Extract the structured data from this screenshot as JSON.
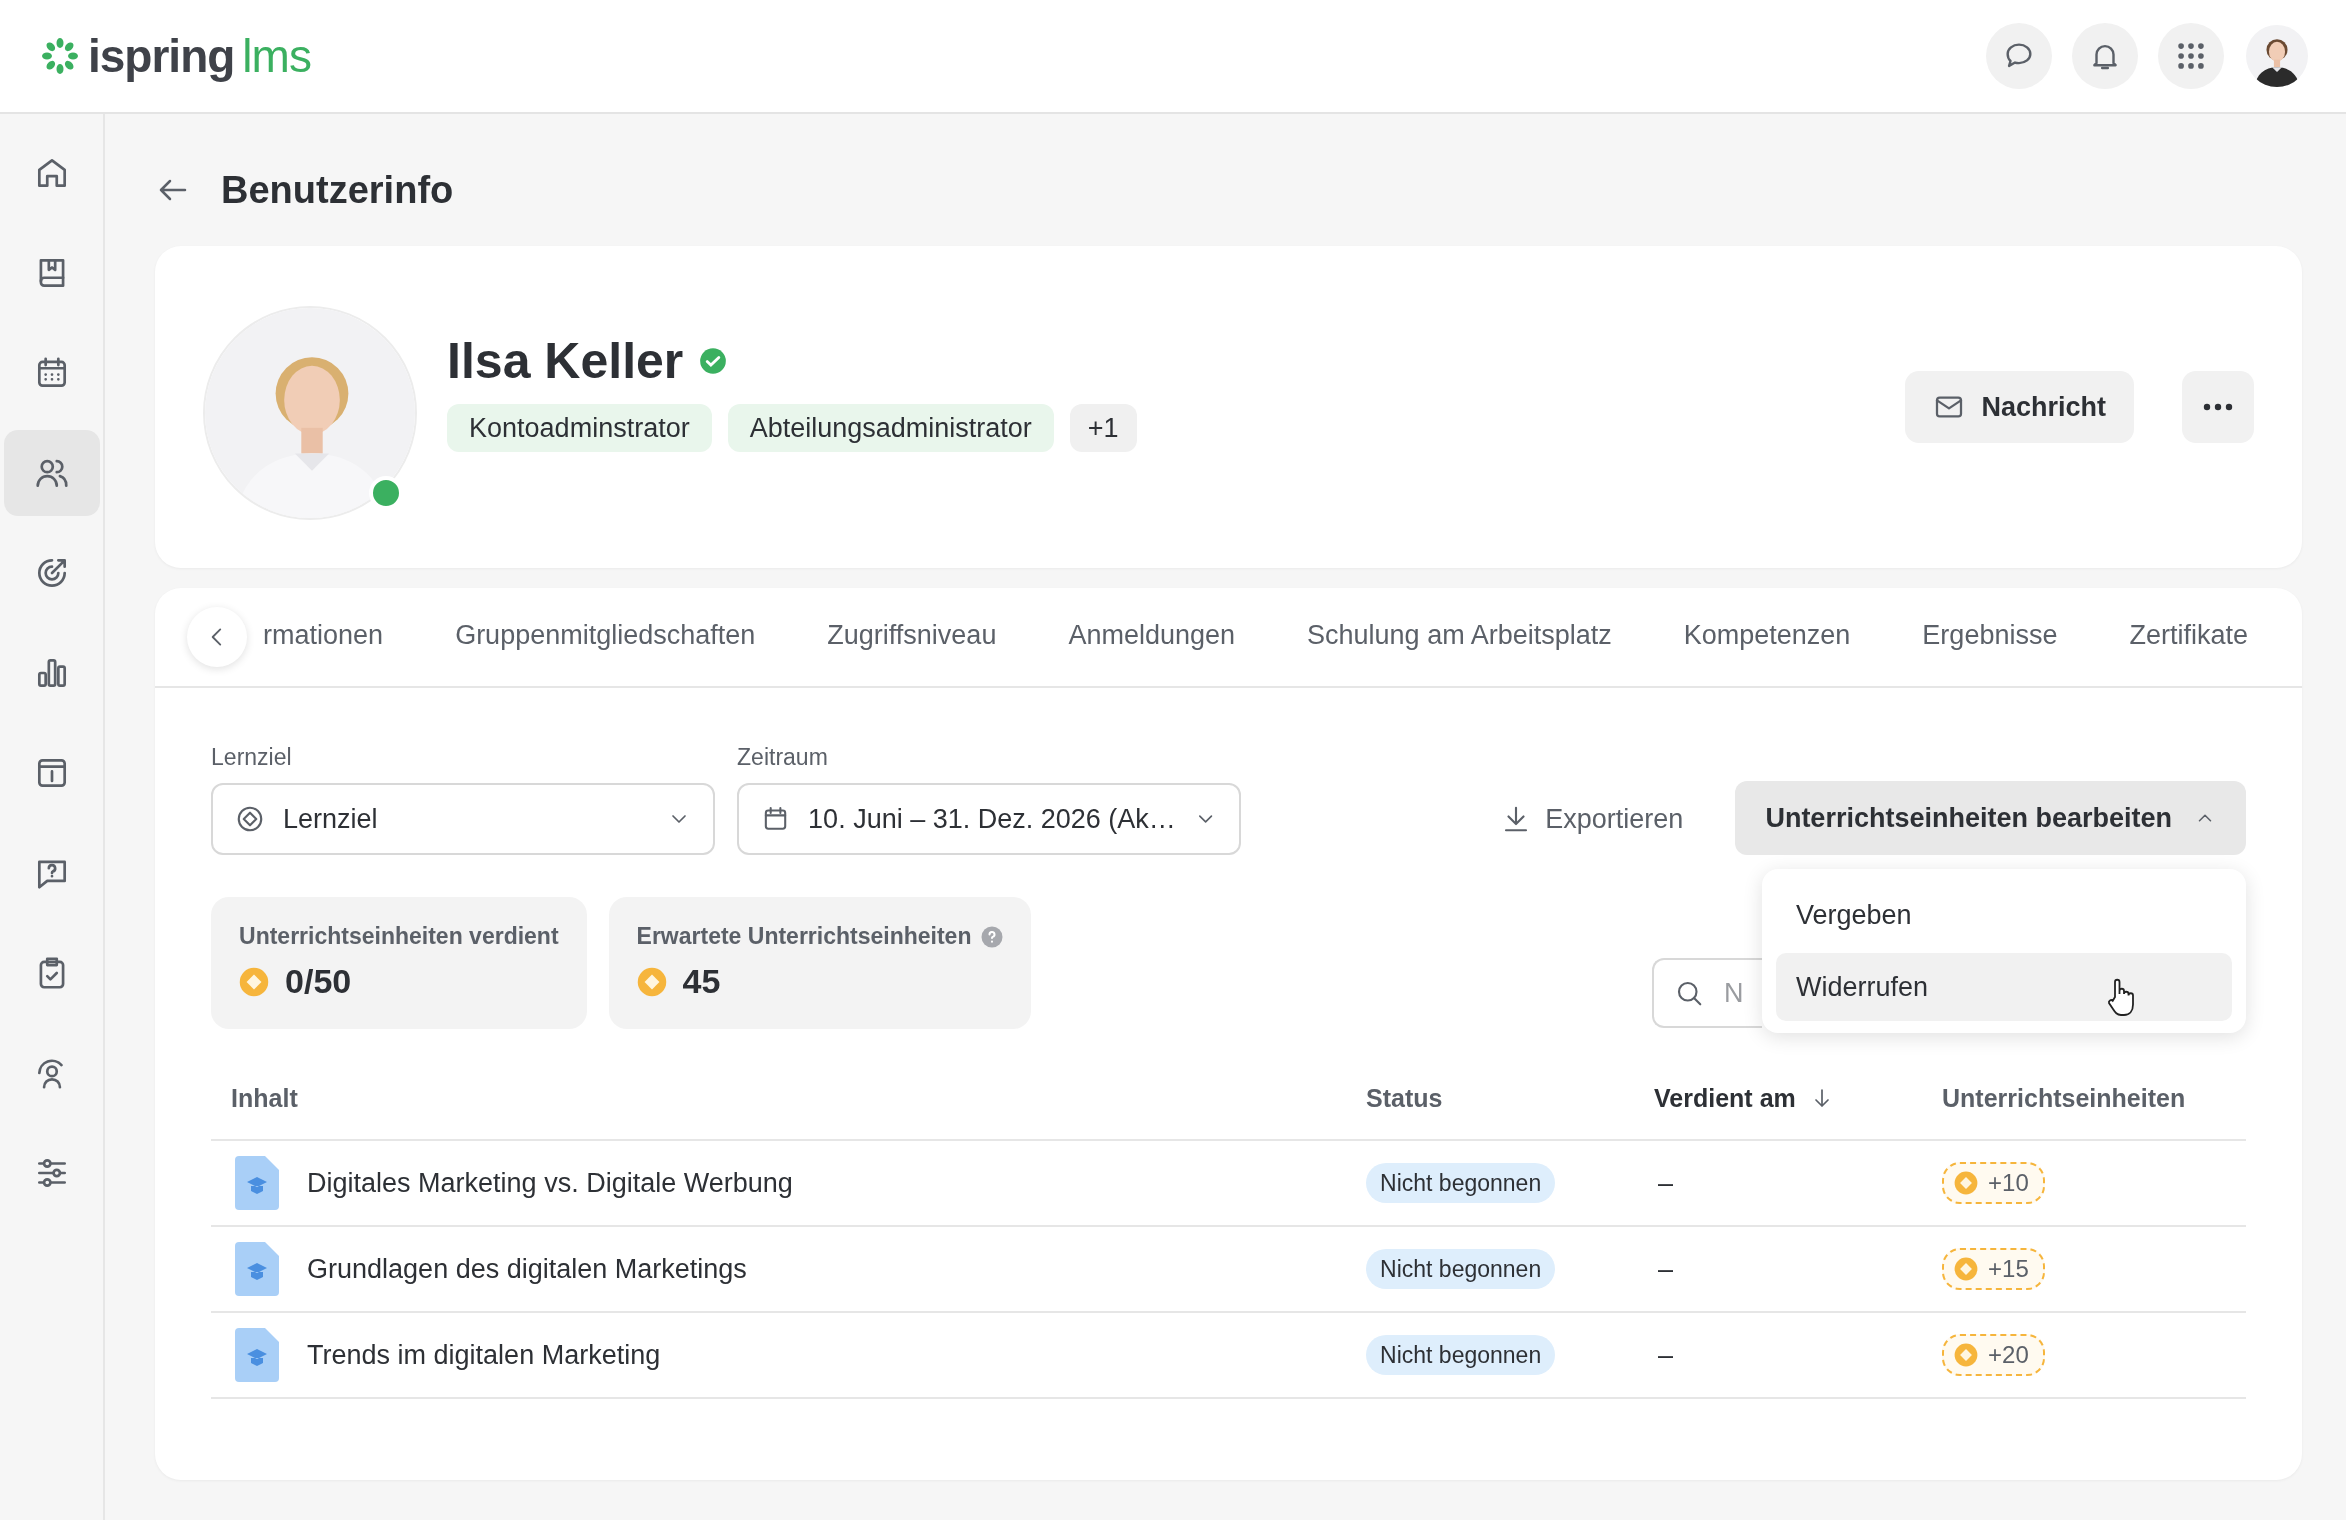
{
  "header": {
    "logo": {
      "word": "ispring",
      "accent": "lms"
    },
    "actions": [
      {
        "kind": "chat"
      },
      {
        "kind": "bell"
      },
      {
        "kind": "apps"
      }
    ]
  },
  "sidebar": {
    "items": [
      {
        "kind": "home",
        "selected": false
      },
      {
        "kind": "book",
        "selected": false
      },
      {
        "kind": "calendar",
        "selected": false
      },
      {
        "kind": "users",
        "selected": true
      },
      {
        "kind": "target",
        "selected": false
      },
      {
        "kind": "chart",
        "selected": false
      },
      {
        "kind": "info",
        "selected": false
      },
      {
        "kind": "question",
        "selected": false
      },
      {
        "kind": "clipboard",
        "selected": false
      },
      {
        "kind": "person",
        "selected": false
      },
      {
        "kind": "sliders",
        "selected": false
      }
    ]
  },
  "page": {
    "title": "Benutzerinfo"
  },
  "profile": {
    "name": "Ilsa Keller",
    "verified": true,
    "online": true,
    "roles": [
      "Kontoadminstrator",
      "Abteilungsadministrator"
    ],
    "more_roles": "+1",
    "message_button": "Nachricht"
  },
  "tabs": [
    {
      "label": "rmationen",
      "selected": false
    },
    {
      "label": "Gruppenmitgliedschaften",
      "selected": false
    },
    {
      "label": "Zugriffsniveau",
      "selected": false
    },
    {
      "label": "Anmeldungen",
      "selected": false
    },
    {
      "label": "Schulung am Arbeitsplatz",
      "selected": false
    },
    {
      "label": "Kompetenzen",
      "selected": false
    },
    {
      "label": "Ergebnisse",
      "selected": false
    },
    {
      "label": "Zertifikate",
      "selected": false
    }
  ],
  "filters": {
    "goal": {
      "label": "Lernziel",
      "value": "Lernziel"
    },
    "period": {
      "label": "Zeitraum",
      "value": "10. Juni – 31. Dez. 2026 (Ak…"
    },
    "export": "Exportieren",
    "edit_button": {
      "label": "Unterrichtseinheiten bearbeiten",
      "expanded": true
    },
    "menu": [
      {
        "label": "Vergeben",
        "selected": false
      },
      {
        "label": "Widerrufen",
        "selected": true
      }
    ]
  },
  "stats": [
    {
      "label": "Unterrichtseinheiten verdient",
      "value": "0/50",
      "help": false
    },
    {
      "label": "Erwartete Unterrichtseinheiten",
      "value": "45",
      "help": true
    }
  ],
  "search": {
    "placeholder": "N"
  },
  "table": {
    "columns": [
      {
        "label": "Inhalt",
        "sorted": false
      },
      {
        "label": "Status",
        "sorted": false
      },
      {
        "label": "Verdient am",
        "sorted": true
      },
      {
        "label": "Unterrichtseinheiten",
        "sorted": false
      }
    ],
    "rows": [
      {
        "content": "Digitales Marketing vs. Digitale Werbung",
        "status": "Nicht begonnen",
        "earned": "–",
        "units": "+10"
      },
      {
        "content": "Grundlagen des digitalen Marketings",
        "status": "Nicht begonnen",
        "earned": "–",
        "units": "+15"
      },
      {
        "content": "Trends im digitalen Marketing",
        "status": "Nicht begonnen",
        "earned": "–",
        "units": "+20"
      }
    ]
  }
}
